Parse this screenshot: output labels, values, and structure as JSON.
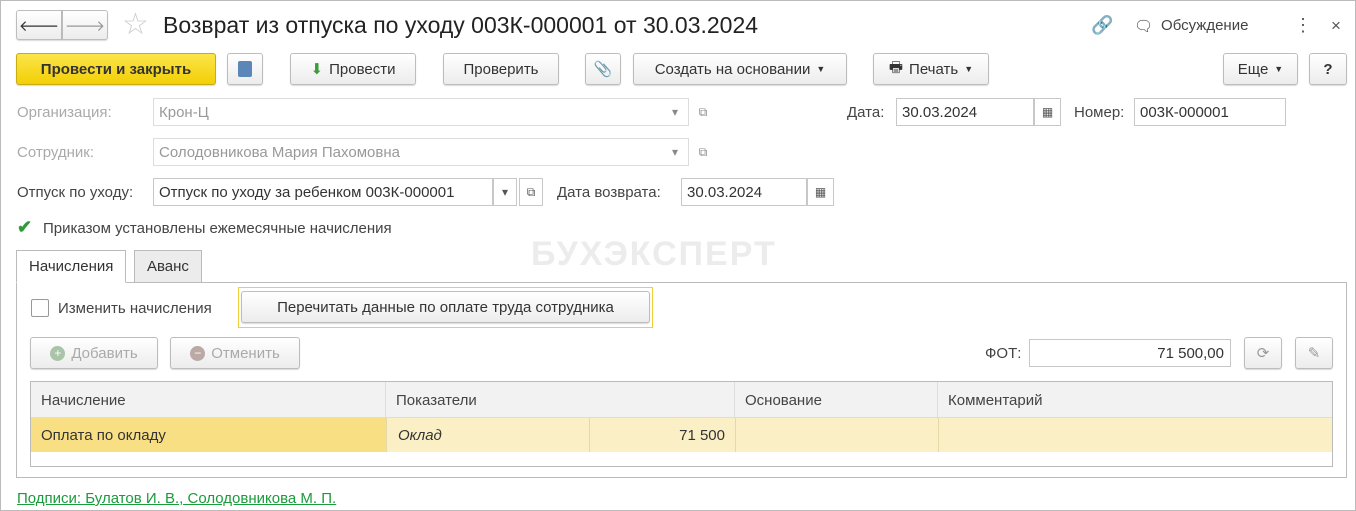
{
  "header": {
    "title": "Возврат из отпуска по уходу 003К-000001 от 30.03.2024",
    "discussion": "Обсуждение"
  },
  "toolbar": {
    "post_close": "Провести и закрыть",
    "post": "Провести",
    "check": "Проверить",
    "create_based": "Создать на основании",
    "print": "Печать",
    "more": "Еще",
    "help": "?"
  },
  "form": {
    "org_label": "Организация:",
    "org_value": "Крон-Ц",
    "employee_label": "Сотрудник:",
    "employee_value": "Солодовникова Мария Пахомовна",
    "leave_label": "Отпуск по уходу:",
    "leave_value": "Отпуск по уходу за ребенком 003К-000001",
    "return_date_label": "Дата возврата:",
    "return_date_value": "30.03.2024",
    "date_label": "Дата:",
    "date_value": "30.03.2024",
    "number_label": "Номер:",
    "number_value": "003К-000001",
    "monthly_label": "Приказом установлены ежемесячные начисления",
    "monthly_checked": true
  },
  "watermark": "БУХЭКСПЕРТ",
  "tabs": [
    {
      "label": "Начисления"
    },
    {
      "label": "Аванс"
    }
  ],
  "accruals": {
    "change_label": "Изменить начисления",
    "reread": "Перечитать данные по оплате труда сотрудника",
    "add": "Добавить",
    "cancel": "Отменить",
    "fot_label": "ФОТ:",
    "fot_value": "71 500,00",
    "columns": [
      "Начисление",
      "Показатели",
      "Основание",
      "Комментарий"
    ],
    "rows": [
      {
        "accrual": "Оплата по окладу",
        "indicator": "Оклад",
        "value": "71 500",
        "basis": "",
        "comment": ""
      }
    ]
  },
  "footer": {
    "signatures": "Подписи: Булатов И. В., Солодовникова М. П."
  }
}
